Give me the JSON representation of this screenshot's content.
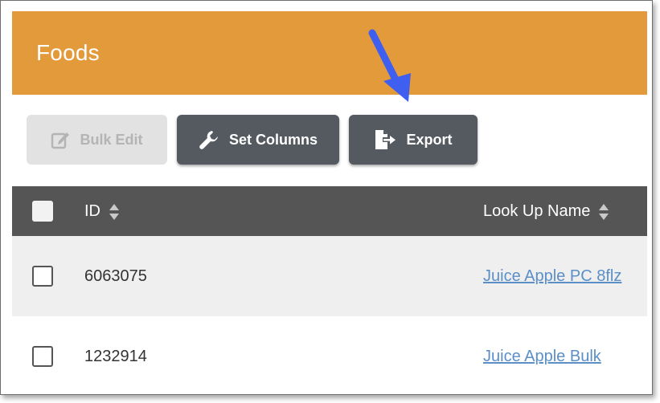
{
  "header": {
    "title": "Foods"
  },
  "toolbar": {
    "bulk_edit_label": "Bulk Edit",
    "set_columns_label": "Set Columns",
    "export_label": "Export"
  },
  "table": {
    "columns": [
      {
        "label": "ID"
      },
      {
        "label": "Look Up Name"
      }
    ],
    "rows": [
      {
        "id": "6063075",
        "name": "Juice Apple PC 8flz"
      },
      {
        "id": "1232914",
        "name": "Juice Apple Bulk"
      }
    ]
  },
  "colors": {
    "header": "#e39a3a",
    "button_dark": "#555a60",
    "table_header": "#555555",
    "link": "#5b8fc6",
    "annotation_arrow": "#3f5ff0"
  },
  "icons": {
    "bulk_edit": "edit-icon",
    "set_columns": "wrench-icon",
    "export": "file-export-icon",
    "sort": "sort-icon"
  }
}
